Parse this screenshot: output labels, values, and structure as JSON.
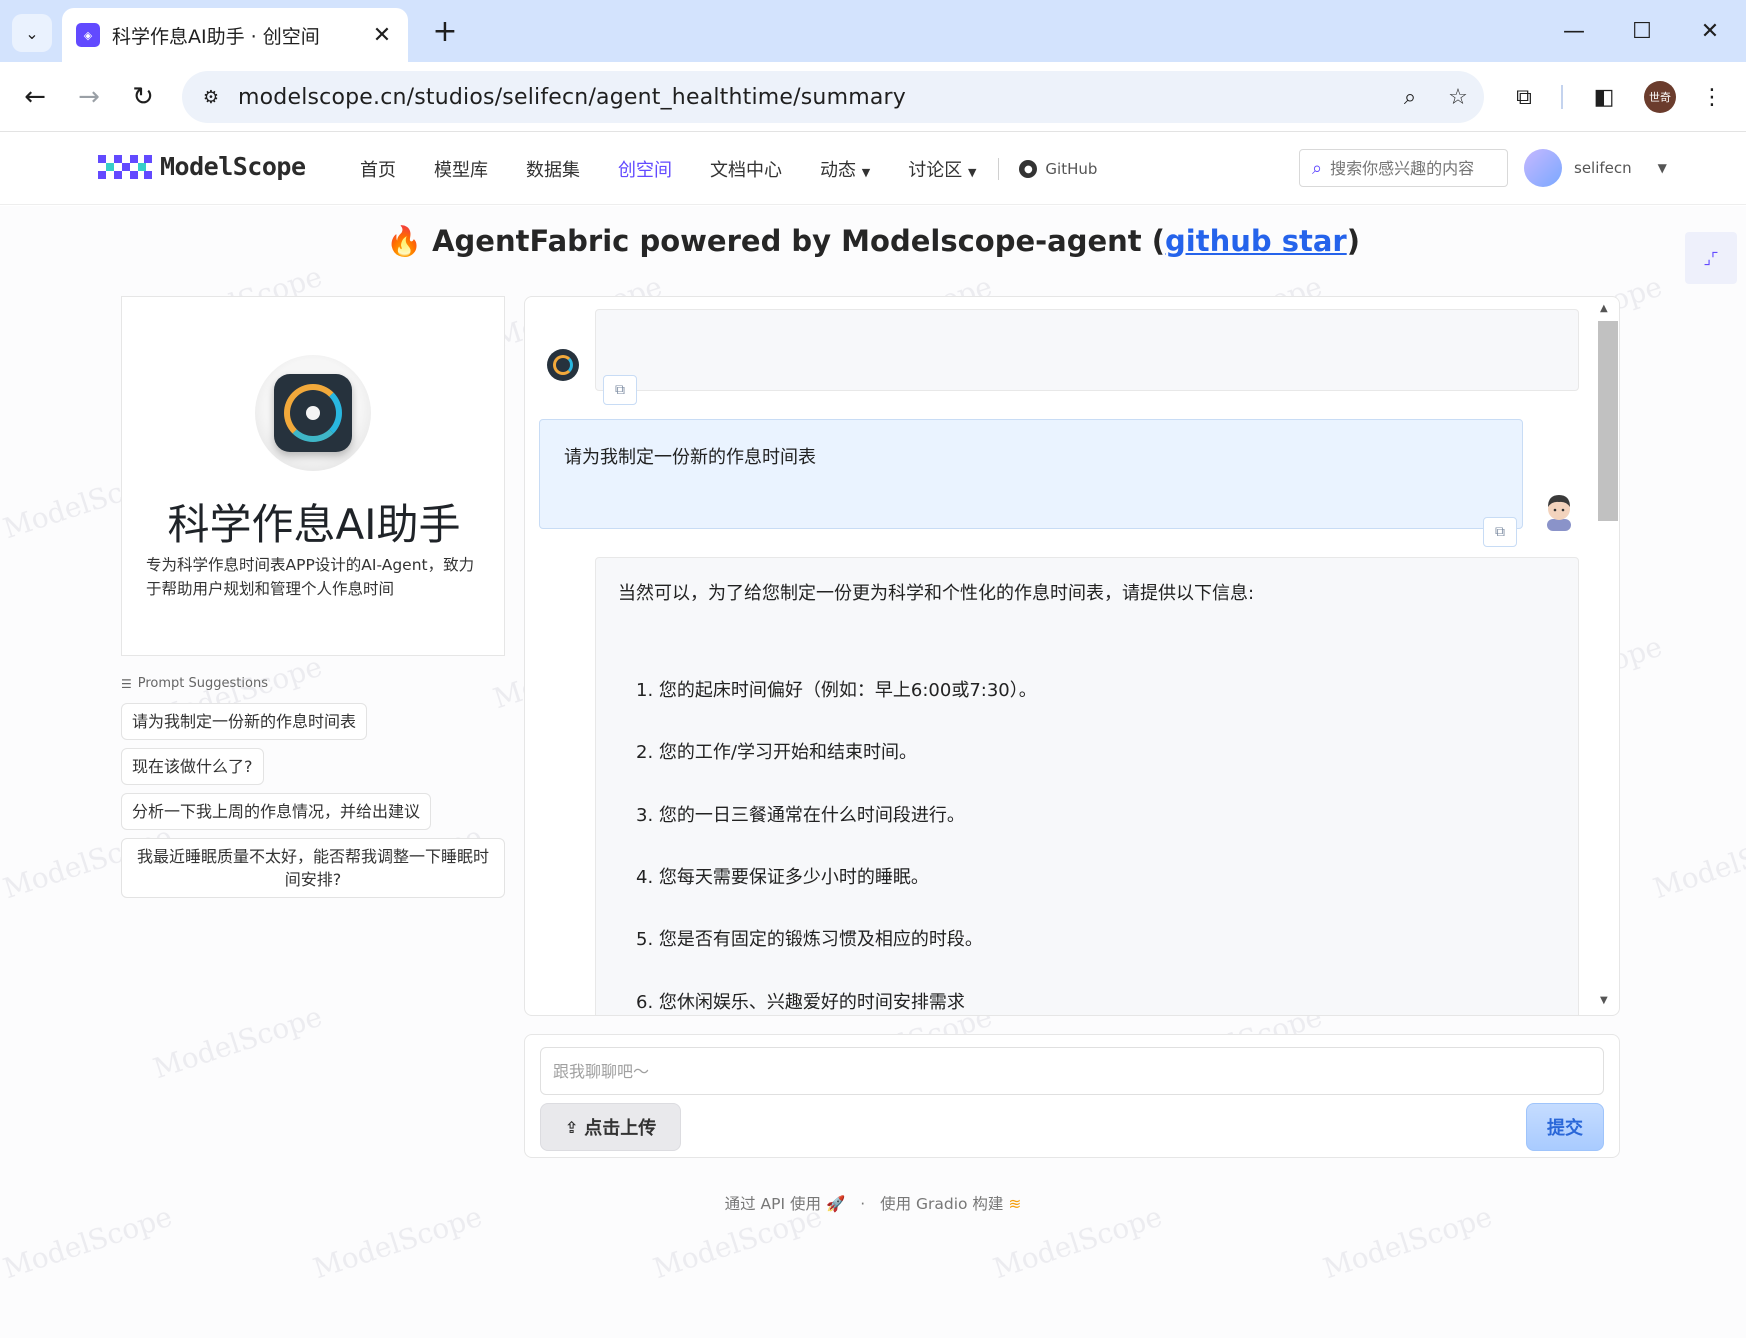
{
  "browser": {
    "tab_title": "科学作息AI助手 · 创空间",
    "url": "modelscope.cn/studios/selifecn/agent_healthtime/summary",
    "profile_initials": "世奇"
  },
  "site": {
    "logo_text": "ModelScope",
    "nav": [
      "首页",
      "模型库",
      "数据集",
      "创空间",
      "文档中心",
      "动态",
      "讨论区"
    ],
    "nav_active": "创空间",
    "github_label": "GitHub",
    "search_placeholder": "搜索你感兴趣的内容",
    "username": "selifecn",
    "accent_color": "#624aff"
  },
  "app": {
    "title_prefix": "AgentFabric powered by Modelscope-agent (",
    "title_link": "github star",
    "title_suffix": ")"
  },
  "agent": {
    "name": "科学作息AI助手",
    "description": "专为科学作息时间表APP设计的AI-Agent，致力于帮助用户规划和管理个人作息时间"
  },
  "prompts": {
    "label": "Prompt Suggestions",
    "items": [
      "请为我制定一份新的作息时间表",
      "现在该做什么了?",
      "分析一下我上周的作息情况，并给出建议",
      "我最近睡眠质量不太好，能否帮我调整一下睡眠时间安排?"
    ]
  },
  "chat": {
    "messages": [
      {
        "role": "bot",
        "text": ""
      },
      {
        "role": "user",
        "text": "请为我制定一份新的作息时间表"
      },
      {
        "role": "bot",
        "intro": "当然可以，为了给您制定一份更为科学和个性化的作息时间表，请提供以下信息:",
        "list": [
          "1. 您的起床时间偏好（例如：早上6:00或7:30）。",
          "2. 您的工作/学习开始和结束时间。",
          "3. 您的一日三餐通常在什么时间段进行。",
          "4. 您每天需要保证多少小时的睡眠。",
          "5. 您是否有固定的锻炼习惯及相应的时段。",
          "6. 您休闲娱乐、兴趣爱好的时间安排需求"
        ]
      }
    ]
  },
  "input": {
    "placeholder": "跟我聊聊吧～",
    "upload_label": "点击上传",
    "submit_label": "提交"
  },
  "footer": {
    "api_label": "通过 API 使用",
    "separator": "·",
    "gradio_label": "使用 Gradio 构建"
  }
}
